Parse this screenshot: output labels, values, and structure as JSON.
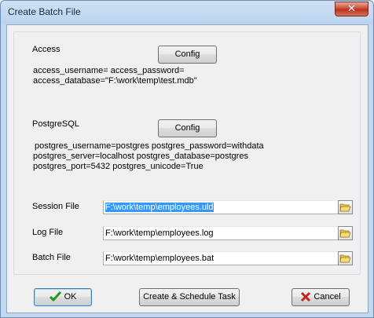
{
  "window": {
    "title": "Create Batch File"
  },
  "close_icon": "close-icon",
  "access": {
    "heading": "Access",
    "config_label": "Config",
    "line1": "access_username= access_password=",
    "line2": "access_database=\"F:\\work\\temp\\test.mdb\""
  },
  "postgres": {
    "heading": "PostgreSQL",
    "config_label": "Config",
    "line1": "postgres_username=postgres postgres_password=withdata",
    "line2": "postgres_server=localhost postgres_database=postgres",
    "line3": "postgres_port=5432 postgres_unicode=True"
  },
  "files": {
    "session_label": "Session File",
    "session_value": "F:\\work\\temp\\employees.uld",
    "log_label": "Log File",
    "log_value": "F:\\work\\temp\\employees.log",
    "batch_label": "Batch File",
    "batch_value": "F:\\work\\temp\\employees.bat"
  },
  "buttons": {
    "ok": "OK",
    "schedule": "Create & Schedule Task",
    "cancel": "Cancel"
  },
  "colors": {
    "ok_check": "#1f9b1f",
    "cancel_x": "#c0281c",
    "selection": "#3399ff"
  }
}
